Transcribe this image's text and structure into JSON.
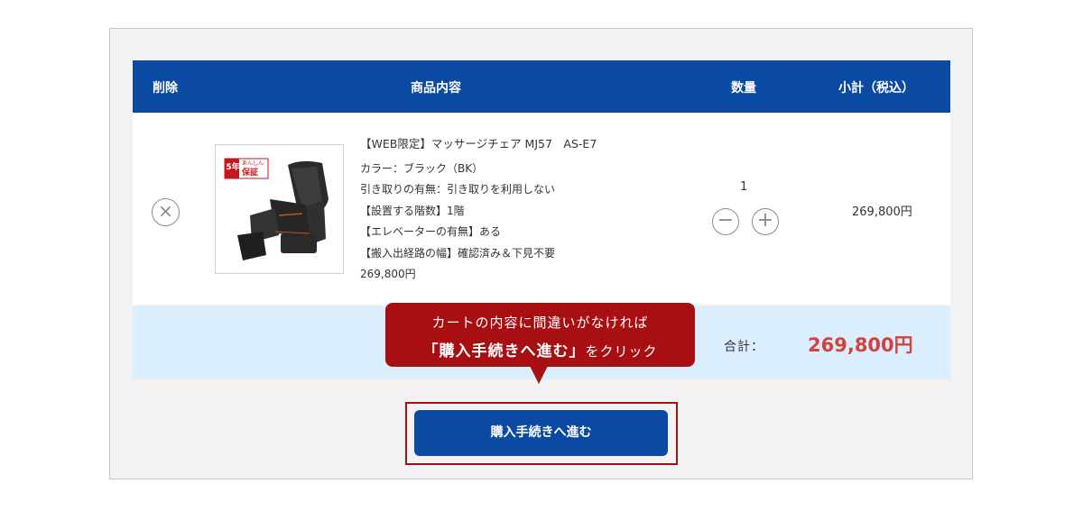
{
  "table": {
    "headers": {
      "remove": "削除",
      "product": "商品内容",
      "quantity": "数量",
      "subtotal": "小計（税込）"
    }
  },
  "item": {
    "badge_years": "5年",
    "badge_text1": "あんしん",
    "badge_text2": "保証",
    "title": "【WEB限定】マッサージチェア MJ57　AS-E7",
    "options": [
      "カラー：ブラック（BK）",
      "引き取りの有無：引き取りを利用しない",
      "【設置する階数】1階",
      "【エレベーターの有無】ある",
      "【搬入出経路の幅】確認済み＆下見不要"
    ],
    "price": "269,800円",
    "quantity": "1",
    "subtotal": "269,800円"
  },
  "total": {
    "label": "合計：",
    "value": "269,800円"
  },
  "tooltip": {
    "line1": "カートの内容に間違いがなければ",
    "line2_bold": "「購入手続きへ進む」",
    "line2_rest": "をクリック"
  },
  "checkout_button": "購入手続きへ進む",
  "colors": {
    "header_blue": "#0b4aa3",
    "total_bg": "#dbeefd",
    "accent_red": "#a80f12",
    "total_price_red": "#d2433b"
  }
}
